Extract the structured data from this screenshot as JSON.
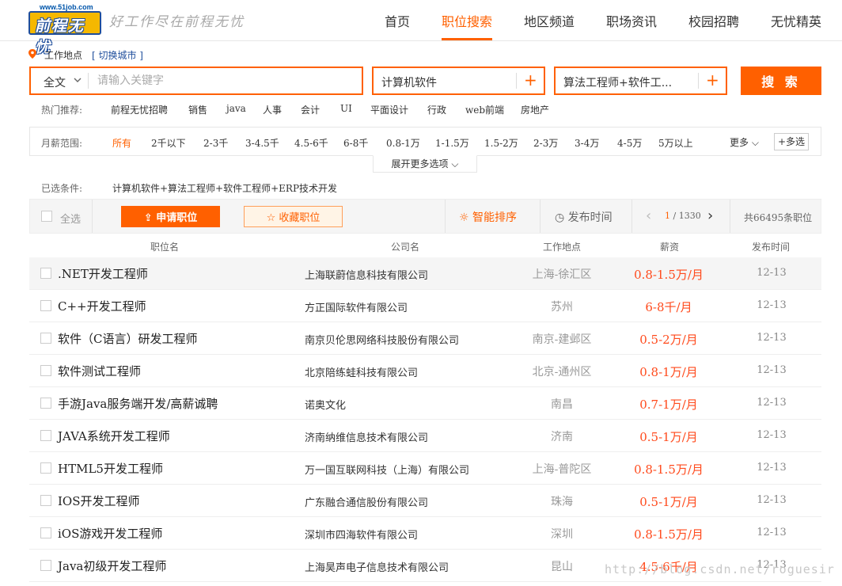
{
  "header": {
    "logo_url_text": "www.51job.com",
    "logo_name": "前程无忧",
    "slogan": "好工作尽在前程无忧",
    "nav": [
      "首页",
      "职位搜索",
      "地区频道",
      "职场资讯",
      "校园招聘",
      "无忧精英"
    ],
    "active_nav": "职位搜索"
  },
  "location": {
    "label": "工作地点",
    "switch": "[ 切换城市 ]"
  },
  "search": {
    "scope": "全文",
    "placeholder": "请输入关键字",
    "industry": "计算机软件",
    "function": "算法工程师+软件工...",
    "button": "搜 索"
  },
  "hot": {
    "label": "热门推荐:",
    "items": [
      "前程无忧招聘",
      "销售",
      "java",
      "人事",
      "会计",
      "UI",
      "平面设计",
      "行政",
      "web前端",
      "房地产"
    ]
  },
  "salary": {
    "label": "月薪范围:",
    "items": [
      "所有",
      "2千以下",
      "2-3千",
      "3-4.5千",
      "4.5-6千",
      "6-8千",
      "0.8-1万",
      "1-1.5万",
      "1.5-2万",
      "2-3万",
      "3-4万",
      "4-5万",
      "5万以上"
    ],
    "more": "更多",
    "multi": "多选",
    "expand": "展开更多选项"
  },
  "selected": {
    "label": "已选条件:",
    "value": "计算机软件+算法工程师+软件工程师+ERP技术开发"
  },
  "toolbar": {
    "select_all": "全选",
    "apply": "申请职位",
    "favorite": "收藏职位",
    "smart_sort": "智能排序",
    "time_sort": "发布时间",
    "page_current": "1",
    "page_total": " / 1330",
    "total": "共66495条职位"
  },
  "columns": [
    "职位名",
    "公司名",
    "工作地点",
    "薪资",
    "发布时间"
  ],
  "jobs": [
    {
      "title": ".NET开发工程师",
      "company": "上海联蔚信息科技有限公司",
      "location": "上海-徐汇区",
      "salary": "0.8-1.5万/月",
      "date": "12-13"
    },
    {
      "title": "C++开发工程师",
      "company": "方正国际软件有限公司",
      "location": "苏州",
      "salary": "6-8千/月",
      "date": "12-13"
    },
    {
      "title": "软件（C语言）研发工程师",
      "company": "南京贝伦思网络科技股份有限公司",
      "location": "南京-建邺区",
      "salary": "0.5-2万/月",
      "date": "12-13"
    },
    {
      "title": "软件测试工程师",
      "company": "北京陪练蛙科技有限公司",
      "location": "北京-通州区",
      "salary": "0.8-1万/月",
      "date": "12-13"
    },
    {
      "title": "手游Java服务端开发/高薪诚聘",
      "company": "诺奥文化",
      "location": "南昌",
      "salary": "0.7-1万/月",
      "date": "12-13"
    },
    {
      "title": "JAVA系统开发工程师",
      "company": "济南纳维信息技术有限公司",
      "location": "济南",
      "salary": "0.5-1万/月",
      "date": "12-13"
    },
    {
      "title": "HTML5开发工程师",
      "company": "万一国互联网科技（上海）有限公司",
      "location": "上海-普陀区",
      "salary": "0.8-1.5万/月",
      "date": "12-13"
    },
    {
      "title": "IOS开发工程师",
      "company": "广东融合通信股份有限公司",
      "location": "珠海",
      "salary": "0.5-1万/月",
      "date": "12-13"
    },
    {
      "title": "iOS游戏开发工程师",
      "company": "深圳市四海软件有限公司",
      "location": "深圳",
      "salary": "0.8-1.5万/月",
      "date": "12-13"
    },
    {
      "title": "Java初级开发工程师",
      "company": "上海昊声电子信息技术有限公司",
      "location": "昆山",
      "salary": "4.5-6千/月",
      "date": "12-13"
    }
  ],
  "watermark": "http://blog.csdn.net/roguesir",
  "colors": {
    "accent": "#ff6000",
    "salary": "#ff4a1c",
    "brand_blue": "#1f4e9c",
    "logo_yellow": "#f5b800"
  }
}
